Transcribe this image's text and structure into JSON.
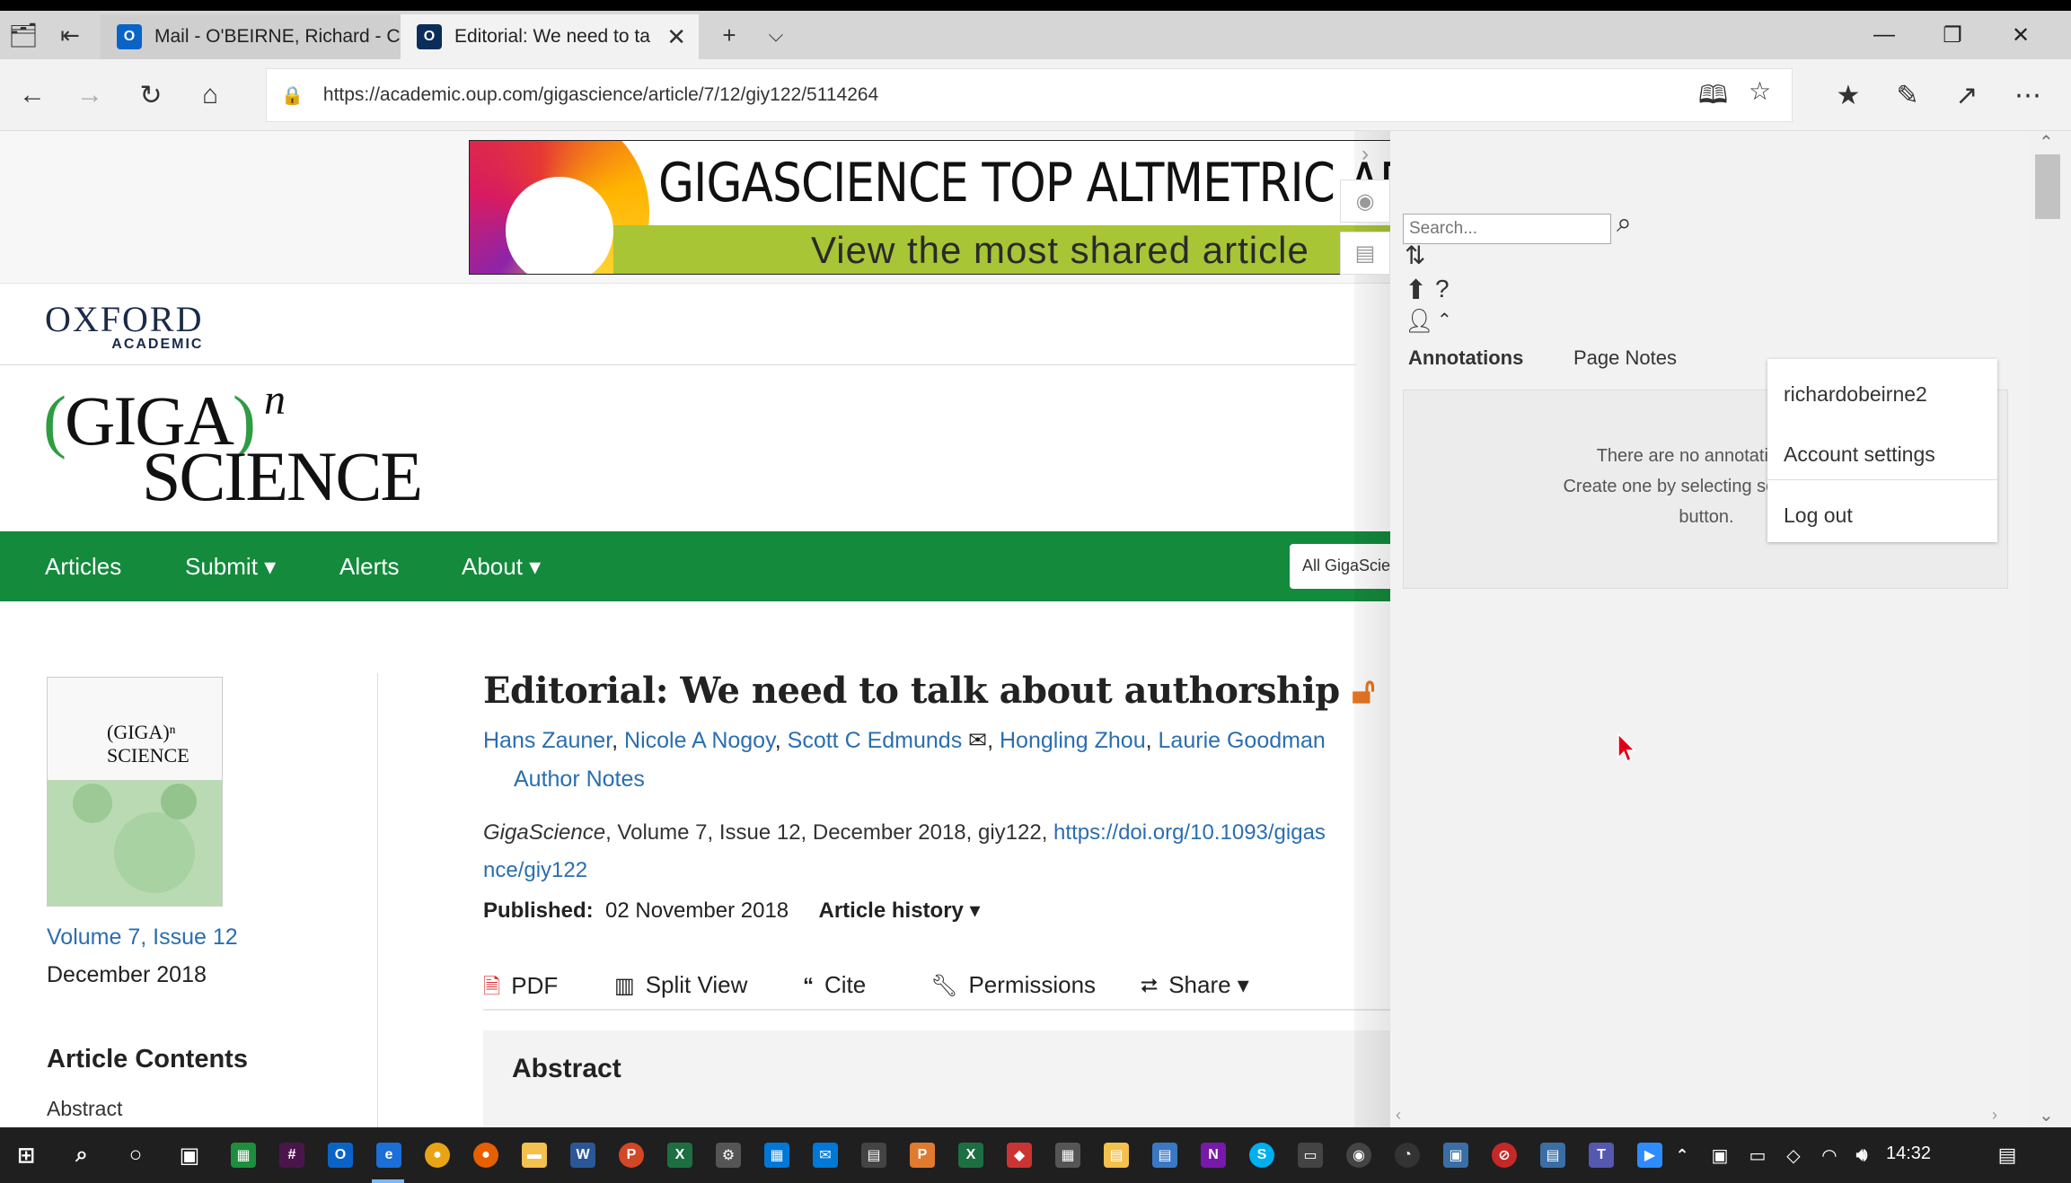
{
  "browser": {
    "tabs": [
      {
        "label": "Mail - O'BEIRNE, Richard - C",
        "favicon": "outlook-icon"
      },
      {
        "label": "Editorial: We need to ta",
        "favicon": "oup-icon",
        "active": true
      }
    ],
    "url": "https://academic.oup.com/gigascience/article/7/12/giy122/5114264"
  },
  "banner": {
    "title": "GIGASCIENCE TOP ALTMETRIC ARTIC",
    "subtitle": "View the most shared article"
  },
  "publisher": {
    "line1": "OXFORD",
    "line2": "ACADEMIC"
  },
  "journal_logo": {
    "line1_paren_open": "(",
    "line1_text": "GIGA",
    "line1_paren_close": ")",
    "superscript": "n",
    "line2": "SCIENCE"
  },
  "sitenav": {
    "items": [
      "Articles",
      "Submit ▾",
      "Alerts",
      "About ▾"
    ],
    "search_scope": "All GigaScie"
  },
  "sidebar": {
    "cover_text": "(GIGA)ⁿ SCIENCE",
    "volume_issue": "Volume 7, Issue 12",
    "date": "December 2018",
    "contents_heading": "Article Contents",
    "contents_first": "Abstract"
  },
  "article": {
    "title": "Editorial: We need to talk about authorship",
    "authors": [
      "Hans Zauner",
      "Nicole A Nogoy",
      "Scott C Edmunds",
      "Hongling Zhou",
      "Laurie Goodman"
    ],
    "author_notes": "Author Notes",
    "journal": "GigaScience",
    "citation": ", Volume 7, Issue 12, December 2018, giy122, ",
    "doi_part1": "https://doi.org/10.1093/gigas",
    "doi_part2": "nce/giy122",
    "published_label": "Published:",
    "published_date": "02 November 2018",
    "history": "Article history ▾",
    "tools": [
      "PDF",
      "Split View",
      "Cite",
      "Permissions",
      "Share ▾"
    ],
    "abstract_heading": "Abstract"
  },
  "hypothesis": {
    "search_placeholder": "Search...",
    "tab_annotations": "Annotations",
    "tab_page_notes": "Page Notes",
    "empty_line1": "There are no annotations in",
    "empty_line2": "Create one by selecting some text a",
    "empty_line3": "button.",
    "menu": [
      "richardobeirne2",
      "Account settings",
      "Log out"
    ]
  },
  "taskbar": {
    "time": "14:32"
  }
}
